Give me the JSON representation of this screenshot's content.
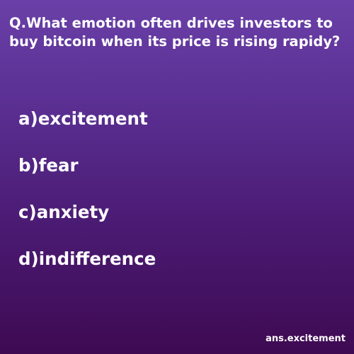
{
  "quiz": {
    "question": "Q.What emotion often drives investors to buy bitcoin when its price is rising rapidy?",
    "options": [
      "a)excitement",
      "b)fear",
      "c)anxiety",
      "d)indifference"
    ],
    "answer": "ans.excitement"
  },
  "colors": {
    "background_top": "#6a40a8",
    "background_bottom": "#3e0a52",
    "text": "#ffffff"
  }
}
